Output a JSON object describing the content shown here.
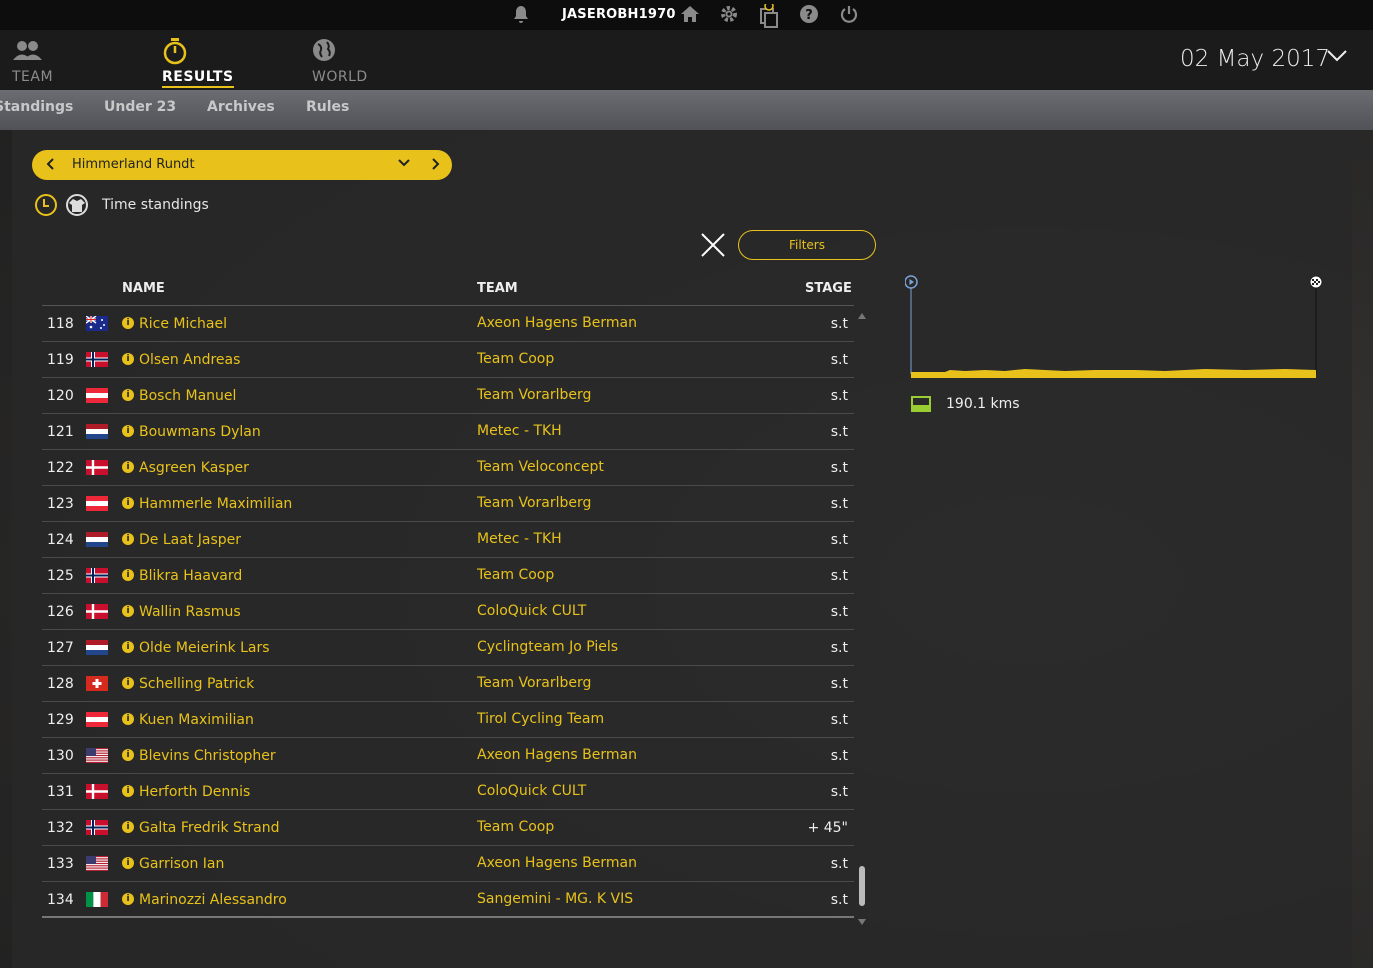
{
  "topbar": {
    "username": "JASEROBH1970",
    "icons": [
      "bell-icon",
      "home-icon",
      "gear-icon",
      "inbox-icon",
      "help-icon",
      "power-icon"
    ]
  },
  "nav": {
    "items": [
      {
        "label": "TEAM",
        "icon": "team-icon",
        "active": false
      },
      {
        "label": "RESULTS",
        "icon": "stopwatch-icon",
        "active": true
      },
      {
        "label": "WORLD",
        "icon": "globe-icon",
        "active": false
      }
    ],
    "date": "02 May 2017"
  },
  "subnav": {
    "items": [
      "Standings",
      "Under 23",
      "Archives",
      "Rules"
    ]
  },
  "race": {
    "name": "Himmerland Rundt",
    "prev": "<",
    "next": ">",
    "dropdown": "⌄"
  },
  "standings": {
    "label": "Time standings"
  },
  "filters": {
    "label": "Filters"
  },
  "table": {
    "headers": {
      "name": "NAME",
      "team": "TEAM",
      "stage": "STAGE"
    },
    "rows": [
      {
        "pos": "118",
        "flag": "AUS",
        "name": "Rice Michael",
        "team": "Axeon Hagens Berman",
        "stage": "s.t"
      },
      {
        "pos": "119",
        "flag": "NOR",
        "name": "Olsen Andreas",
        "team": "Team Coop",
        "stage": "s.t"
      },
      {
        "pos": "120",
        "flag": "AUT",
        "name": "Bosch Manuel",
        "team": "Team Vorarlberg",
        "stage": "s.t"
      },
      {
        "pos": "121",
        "flag": "NED",
        "name": "Bouwmans Dylan",
        "team": "Metec - TKH",
        "stage": "s.t"
      },
      {
        "pos": "122",
        "flag": "DEN",
        "name": "Asgreen Kasper",
        "team": "Team Veloconcept",
        "stage": "s.t"
      },
      {
        "pos": "123",
        "flag": "AUT",
        "name": "Hammerle Maximilian",
        "team": "Team Vorarlberg",
        "stage": "s.t"
      },
      {
        "pos": "124",
        "flag": "NED",
        "name": "De Laat Jasper",
        "team": "Metec - TKH",
        "stage": "s.t"
      },
      {
        "pos": "125",
        "flag": "NOR",
        "name": "Blikra Haavard",
        "team": "Team Coop",
        "stage": "s.t"
      },
      {
        "pos": "126",
        "flag": "DEN",
        "name": "Wallin Rasmus",
        "team": "ColoQuick CULT",
        "stage": "s.t"
      },
      {
        "pos": "127",
        "flag": "NED",
        "name": "Olde Meierink Lars",
        "team": "Cyclingteam Jo Piels",
        "stage": "s.t"
      },
      {
        "pos": "128",
        "flag": "SUI",
        "name": "Schelling Patrick",
        "team": "Team Vorarlberg",
        "stage": "s.t"
      },
      {
        "pos": "129",
        "flag": "AUT",
        "name": "Kuen Maximilian",
        "team": "Tirol Cycling Team",
        "stage": "s.t"
      },
      {
        "pos": "130",
        "flag": "USA",
        "name": "Blevins Christopher",
        "team": "Axeon Hagens Berman",
        "stage": "s.t"
      },
      {
        "pos": "131",
        "flag": "DEN",
        "name": "Herforth Dennis",
        "team": "ColoQuick CULT",
        "stage": "s.t"
      },
      {
        "pos": "132",
        "flag": "NOR",
        "name": "Galta Fredrik Strand",
        "team": "Team Coop",
        "stage": "+ 45\""
      },
      {
        "pos": "133",
        "flag": "USA",
        "name": "Garrison Ian",
        "team": "Axeon Hagens Berman",
        "stage": "s.t"
      },
      {
        "pos": "134",
        "flag": "ITA",
        "name": "Marinozzi Alessandro",
        "team": "Sangemini - MG. K VIS",
        "stage": "s.t"
      }
    ]
  },
  "profile": {
    "distance": "190.1 kms",
    "accent": "#e8c21a"
  },
  "colors": {
    "accent": "#e8c21a",
    "topbar": "#0d0d0d",
    "nav": "#1c1b1c"
  }
}
